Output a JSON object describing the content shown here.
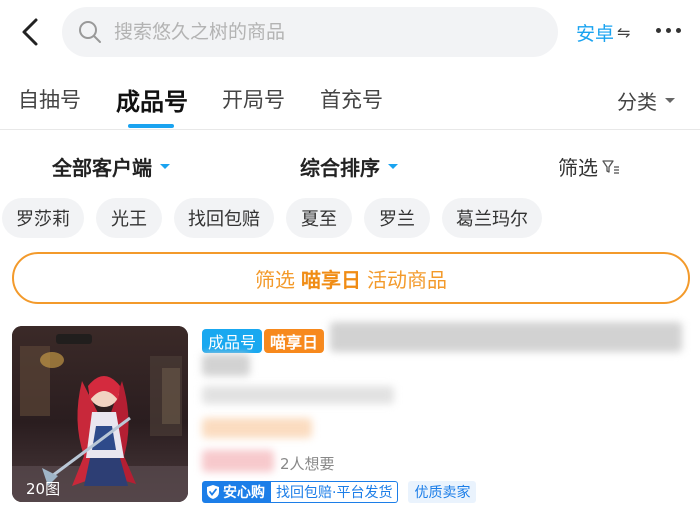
{
  "header": {
    "search_placeholder": "搜索悠久之树的商品",
    "platform_label": "安卓",
    "platform_swap_glyph": "⇋"
  },
  "tabs": [
    {
      "label": "自抽号",
      "active": false
    },
    {
      "label": "成品号",
      "active": true
    },
    {
      "label": "开局号",
      "active": false
    },
    {
      "label": "首充号",
      "active": false
    }
  ],
  "category_label": "分类",
  "filters": {
    "client": "全部客户端",
    "sort": "综合排序",
    "filter": "筛选"
  },
  "chips": [
    "罗莎莉",
    "光王",
    "找回包赔",
    "夏至",
    "罗兰",
    "葛兰玛尔"
  ],
  "promo": {
    "prefix": "筛选",
    "highlight": "喵享日",
    "suffix": "活动商品"
  },
  "product": {
    "image_count": "20图",
    "tags": [
      "成品号",
      "喵享日"
    ],
    "want_count": "2人想要",
    "safe_badge": "安心购",
    "safe_note": "找回包赔·平台发货",
    "seller_badge": "优质卖家"
  },
  "colors": {
    "accent_blue": "#1aa3f0",
    "promo_orange": "#f39a2b",
    "tag_orange": "#f7891d",
    "trust_blue": "#1c7ee8"
  }
}
